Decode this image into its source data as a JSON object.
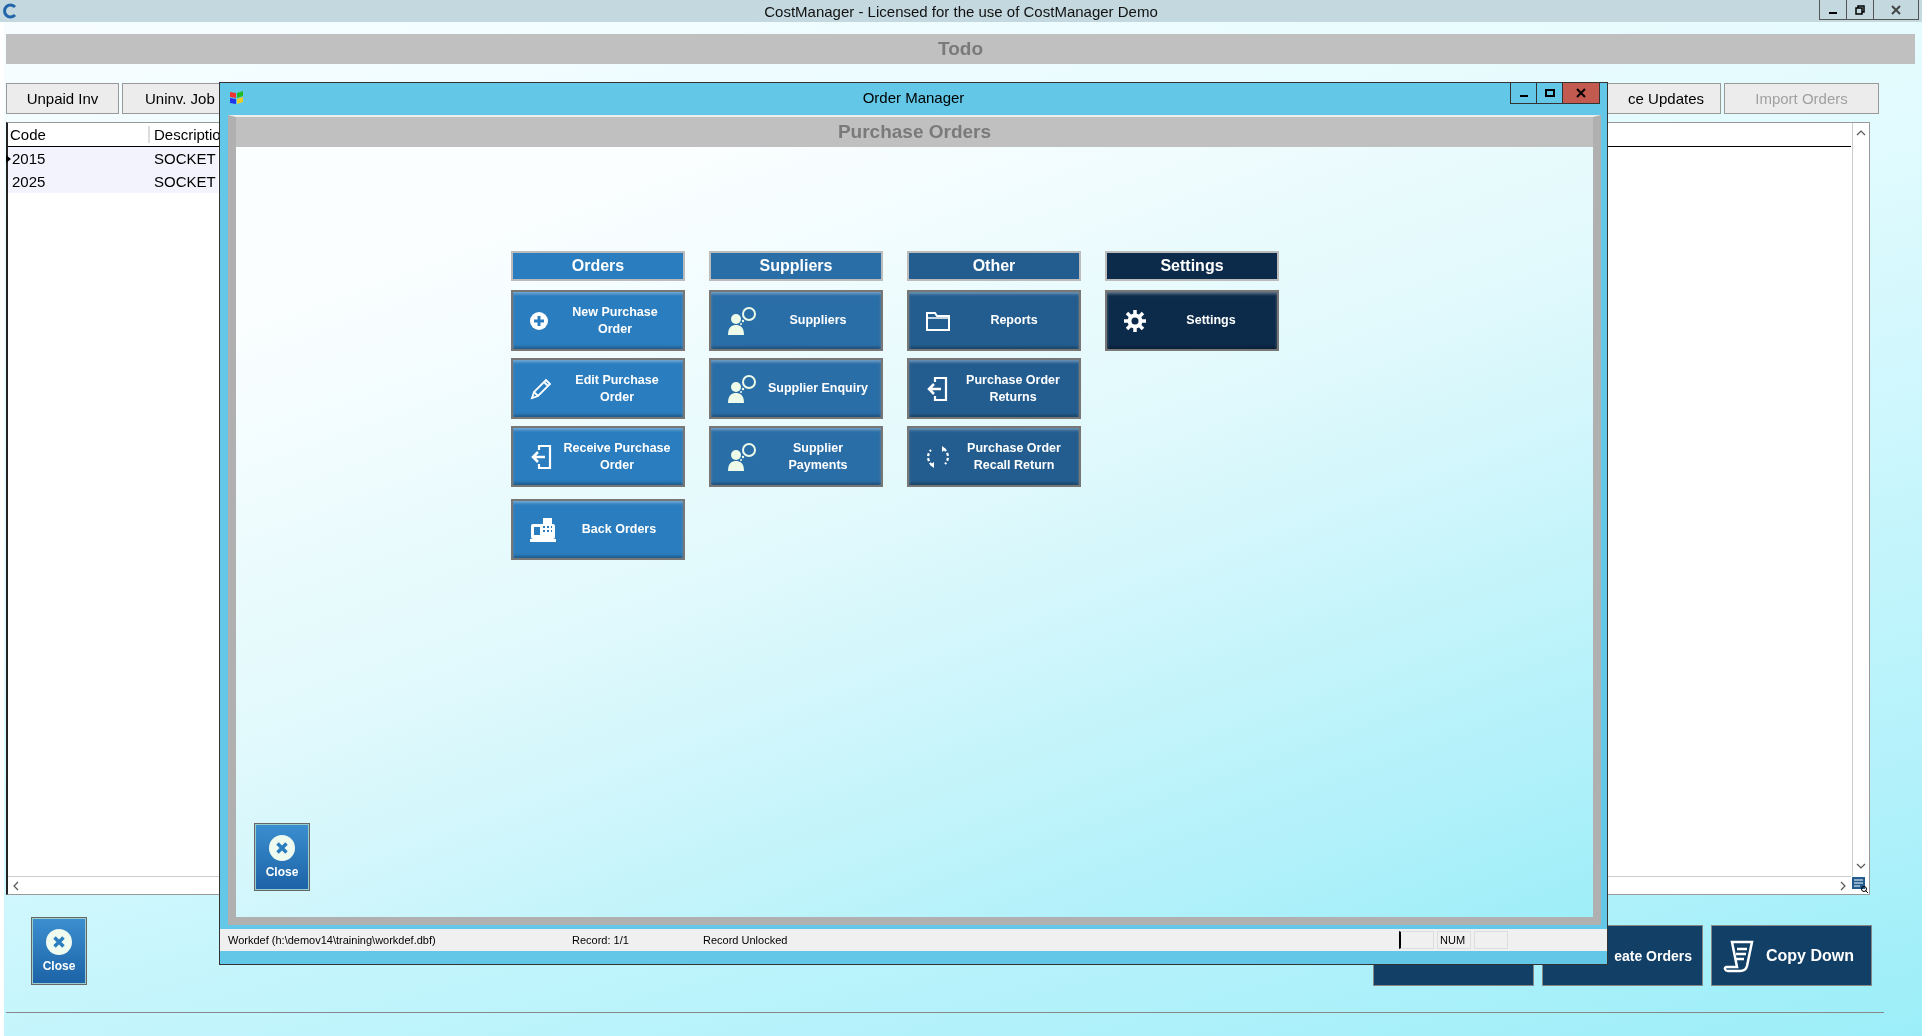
{
  "window": {
    "title": "CostManager - Licensed for the use of CostManager Demo"
  },
  "todo": {
    "title": "Todo"
  },
  "tabs": [
    {
      "label": "Unpaid Inv",
      "disabled": false
    },
    {
      "label": "Uninv. Job",
      "disabled": false
    },
    {
      "label": "ce Updates",
      "disabled": false
    },
    {
      "label": "Import Orders",
      "disabled": true
    }
  ],
  "grid": {
    "columns": [
      "Code",
      "Descriptio"
    ],
    "rows": [
      {
        "code": "2015",
        "description": "SOCKET",
        "current": true
      },
      {
        "code": "2025",
        "description": "SOCKET",
        "current": false
      }
    ]
  },
  "close_button": {
    "label": "Close"
  },
  "actions": [
    {
      "label": "eate Orders"
    },
    {
      "label": "Copy Down"
    }
  ],
  "dialog": {
    "title": "Order Manager",
    "heading": "Purchase Orders",
    "groups": [
      {
        "title": "Orders",
        "color": "#2a7dbf",
        "buttons": [
          "New Purchase Order",
          "Edit Purchase Order",
          "Receive Purchase Order",
          "Back Orders"
        ]
      },
      {
        "title": "Suppliers",
        "color": "#2a6ea8",
        "buttons": [
          "Suppliers",
          "Supplier Enquiry",
          "Supplier Payments"
        ]
      },
      {
        "title": "Other",
        "color": "#235d8f",
        "buttons": [
          "Reports",
          "Purchase Order Returns",
          "Purchase Order Recall Return"
        ]
      },
      {
        "title": "Settings",
        "color": "#0c2b4a",
        "buttons": [
          "Settings"
        ]
      }
    ],
    "close_button": {
      "label": "Close"
    },
    "status_bar": {
      "file": "Workdef (h:\\demov14\\training\\workdef.dbf)",
      "record": "Record: 1/1",
      "lock": "Record Unlocked",
      "indicators": [
        "NUM"
      ]
    }
  }
}
